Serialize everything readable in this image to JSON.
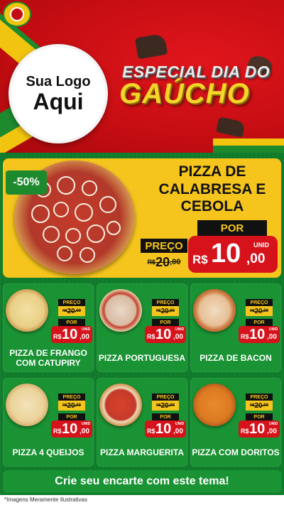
{
  "logo": {
    "line1": "Sua Logo",
    "line2": "Aqui"
  },
  "header": {
    "title_line1": "ESPECIAL DIA DO",
    "title_line2": "GAÚCHO"
  },
  "featured": {
    "discount": "-50%",
    "name": "PIZZA DE CALABRESA E CEBOLA",
    "preco_label": "PREÇO",
    "old_price": {
      "currency": "R$",
      "int": "20",
      "dec": ",00"
    },
    "por_label": "POR",
    "price": {
      "currency": "R$",
      "int": "10",
      "dec": ",00",
      "unit": "UNID"
    }
  },
  "products": [
    {
      "name": "PIZZA DE FRANGO COM CATUPIRY",
      "preco_label": "PREÇO",
      "old": {
        "currency": "R$",
        "int": "20",
        "dec": ",00"
      },
      "por_label": "POR",
      "price": {
        "currency": "R$",
        "int": "10",
        "dec": ",00",
        "unit": "UNID"
      }
    },
    {
      "name": "PIZZA PORTUGUESA",
      "preco_label": "PREÇO",
      "old": {
        "currency": "R$",
        "int": "20",
        "dec": ",00"
      },
      "por_label": "POR",
      "price": {
        "currency": "R$",
        "int": "10",
        "dec": ",00",
        "unit": "UNID"
      }
    },
    {
      "name": "PIZZA DE BACON",
      "preco_label": "PREÇO",
      "old": {
        "currency": "R$",
        "int": "20",
        "dec": ",00"
      },
      "por_label": "POR",
      "price": {
        "currency": "R$",
        "int": "10",
        "dec": ",00",
        "unit": "UNID"
      }
    },
    {
      "name": "PIZZA 4 QUEIJOS",
      "preco_label": "PREÇO",
      "old": {
        "currency": "R$",
        "int": "20",
        "dec": ",00"
      },
      "por_label": "POR",
      "price": {
        "currency": "R$",
        "int": "10",
        "dec": ",00",
        "unit": "UNID"
      }
    },
    {
      "name": "PIZZA MARGUERITA",
      "preco_label": "PREÇO",
      "old": {
        "currency": "R$",
        "int": "20",
        "dec": ",00"
      },
      "por_label": "POR",
      "price": {
        "currency": "R$",
        "int": "10",
        "dec": ",00",
        "unit": "UNID"
      }
    },
    {
      "name": "PIZZA COM DORITOS",
      "preco_label": "PREÇO",
      "old": {
        "currency": "R$",
        "int": "20",
        "dec": ",00"
      },
      "por_label": "POR",
      "price": {
        "currency": "R$",
        "int": "10",
        "dec": ",00",
        "unit": "UNID"
      }
    }
  ],
  "footer": {
    "cta": "Crie seu encarte com este tema!",
    "disclaimer": "*Imagens Meramente Ilustrativas"
  },
  "colors": {
    "header_red": "#c40d12",
    "green": "#0f7a2a",
    "card_green": "#1a9334",
    "yellow": "#f6c51d",
    "price_red": "#d6121b"
  }
}
